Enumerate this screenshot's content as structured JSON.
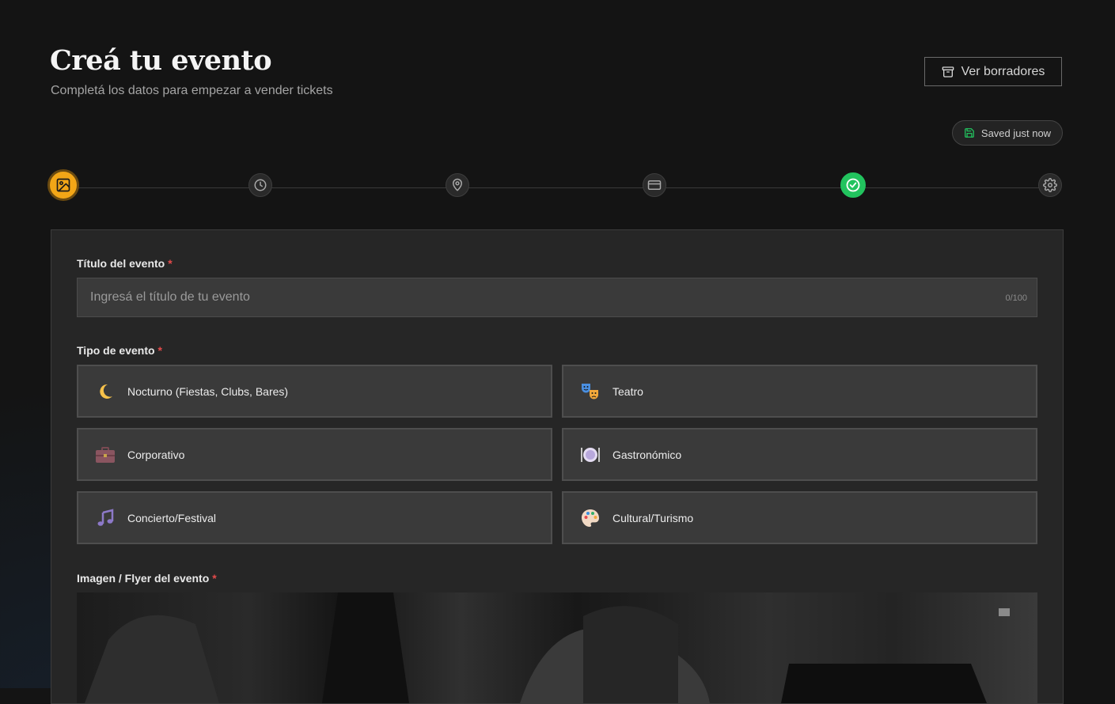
{
  "header": {
    "title": "Creá tu evento",
    "subtitle": "Completá los datos para empezar a vender tickets",
    "drafts_button": "Ver borradores"
  },
  "save_status": "Saved just now",
  "steps": [
    {
      "icon": "image-icon",
      "state": "active"
    },
    {
      "icon": "clock-icon",
      "state": "pending"
    },
    {
      "icon": "map-pin-icon",
      "state": "pending"
    },
    {
      "icon": "credit-card-icon",
      "state": "pending"
    },
    {
      "icon": "check-circle-icon",
      "state": "completed"
    },
    {
      "icon": "gear-icon",
      "state": "pending"
    }
  ],
  "form": {
    "title_field": {
      "label": "Título del evento",
      "required_mark": "*",
      "placeholder": "Ingresá el título de tu evento",
      "value": "",
      "counter": "0/100"
    },
    "event_type": {
      "label": "Tipo de evento",
      "required_mark": "*",
      "options": [
        {
          "label": "Nocturno (Fiestas, Clubs, Bares)",
          "icon": "crescent-moon-icon"
        },
        {
          "label": "Teatro",
          "icon": "theater-masks-icon"
        },
        {
          "label": "Corporativo",
          "icon": "briefcase-icon"
        },
        {
          "label": "Gastronómico",
          "icon": "plate-cutlery-icon"
        },
        {
          "label": "Concierto/Festival",
          "icon": "music-notes-icon"
        },
        {
          "label": "Cultural/Turismo",
          "icon": "palette-icon"
        }
      ]
    },
    "flyer": {
      "label": "Imagen / Flyer del evento",
      "required_mark": "*"
    }
  },
  "colors": {
    "accent": "#f2a617",
    "success": "#22c35e",
    "required": "#e34a4a",
    "background": "#141414",
    "card": "#262626"
  }
}
